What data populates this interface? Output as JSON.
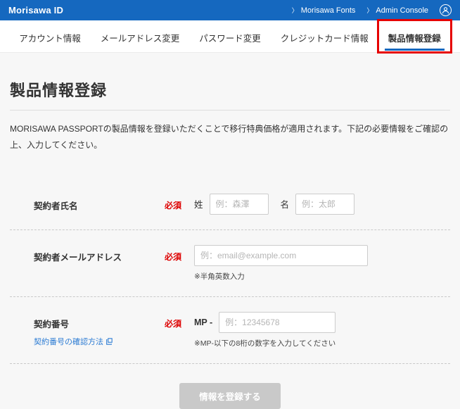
{
  "header": {
    "brand": "Morisawa ID",
    "chevron": "〉",
    "links": [
      {
        "label": "Morisawa Fonts"
      },
      {
        "label": "Admin Console"
      }
    ]
  },
  "nav": {
    "tabs": [
      {
        "label": "アカウント情報"
      },
      {
        "label": "メールアドレス変更"
      },
      {
        "label": "パスワード変更"
      },
      {
        "label": "クレジットカード情報"
      },
      {
        "label": "製品情報登録"
      }
    ],
    "active_tab": "製品情報登録"
  },
  "page": {
    "title": "製品情報登録",
    "description": "MORISAWA PASSPORTの製品情報を登録いただくことで移行特典価格が適用されます。下記の必要情報をご確認の上、入力してください。"
  },
  "form": {
    "required": "必須",
    "name_row": {
      "label": "契約者氏名",
      "last_name_label": "姓",
      "last_name_placeholder": "例：森澤",
      "first_name_label": "名",
      "first_name_placeholder": "例：太郎"
    },
    "email_row": {
      "label": "契約者メールアドレス",
      "placeholder": "例：email@example.com",
      "note": "※半角英数入力"
    },
    "contract_row": {
      "label": "契約番号",
      "link": "契約番号の確認方法",
      "prefix": "MP -",
      "placeholder": "例：12345678",
      "note": "※MP-以下の8桁の数字を入力してください"
    },
    "submit": "情報を登録する"
  },
  "colors": {
    "topbar_blue": "#1568bf",
    "active_underline": "#1568bf",
    "required_red": "#dd0000",
    "annotation_red": "#e60000",
    "link_blue": "#2b7bd3",
    "button_gray": "#c9c9c9"
  }
}
